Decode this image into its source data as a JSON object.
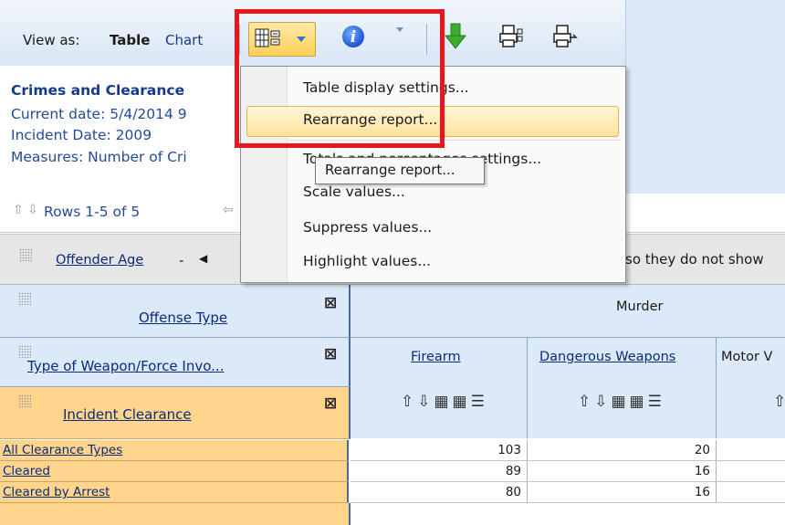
{
  "toolbar": {
    "view_as_label": "View as:",
    "table_label": "Table",
    "chart_label": "Chart"
  },
  "header": {
    "title": "Crimes and Clearance",
    "current_date": "Current date: 5/4/2014 9",
    "incident_date": "Incident Date: 2009",
    "measures": "Measures: Number of Cri"
  },
  "nav": {
    "rows_label": "Rows 1-5 of 5"
  },
  "filter_row": {
    "offender_age": "Offender Age",
    "dash": "-",
    "right_text": "so they do not show"
  },
  "table": {
    "dimensions": [
      {
        "label": "Offense Type"
      },
      {
        "label": "Type of Weapon/Force Invo..."
      },
      {
        "label": "Incident Clearance"
      }
    ],
    "offense_header": "Murder",
    "columns": [
      "Firearm",
      "Dangerous Weapons",
      "Motor V"
    ],
    "rows": [
      {
        "label": "All Clearance Types",
        "firearm": "103",
        "dangerous": "20"
      },
      {
        "label": "Cleared",
        "firearm": "89",
        "dangerous": "16"
      },
      {
        "label": "Cleared by Arrest",
        "firearm": "80",
        "dangerous": "16"
      }
    ]
  },
  "menu": {
    "items": [
      {
        "label": "Table display settings..."
      },
      {
        "label": "Rearrange report..."
      },
      {
        "label": "Totals and percentages settings..."
      },
      {
        "label": "Scale values..."
      },
      {
        "label": "Suppress values..."
      },
      {
        "label": "Highlight values..."
      }
    ],
    "tooltip": "Rearrange report..."
  },
  "colors": {
    "highlight_frame": "#e8151c",
    "header_orange": "#ffd48c",
    "header_blue": "#dce9f8",
    "link_blue": "#0a2a7a"
  },
  "icons": [
    "table-layout-icon",
    "chevron-down-icon",
    "info-icon",
    "download-icon",
    "print-icon",
    "export-icon",
    "sort-up-icon",
    "sort-down-icon",
    "remove-icon"
  ]
}
